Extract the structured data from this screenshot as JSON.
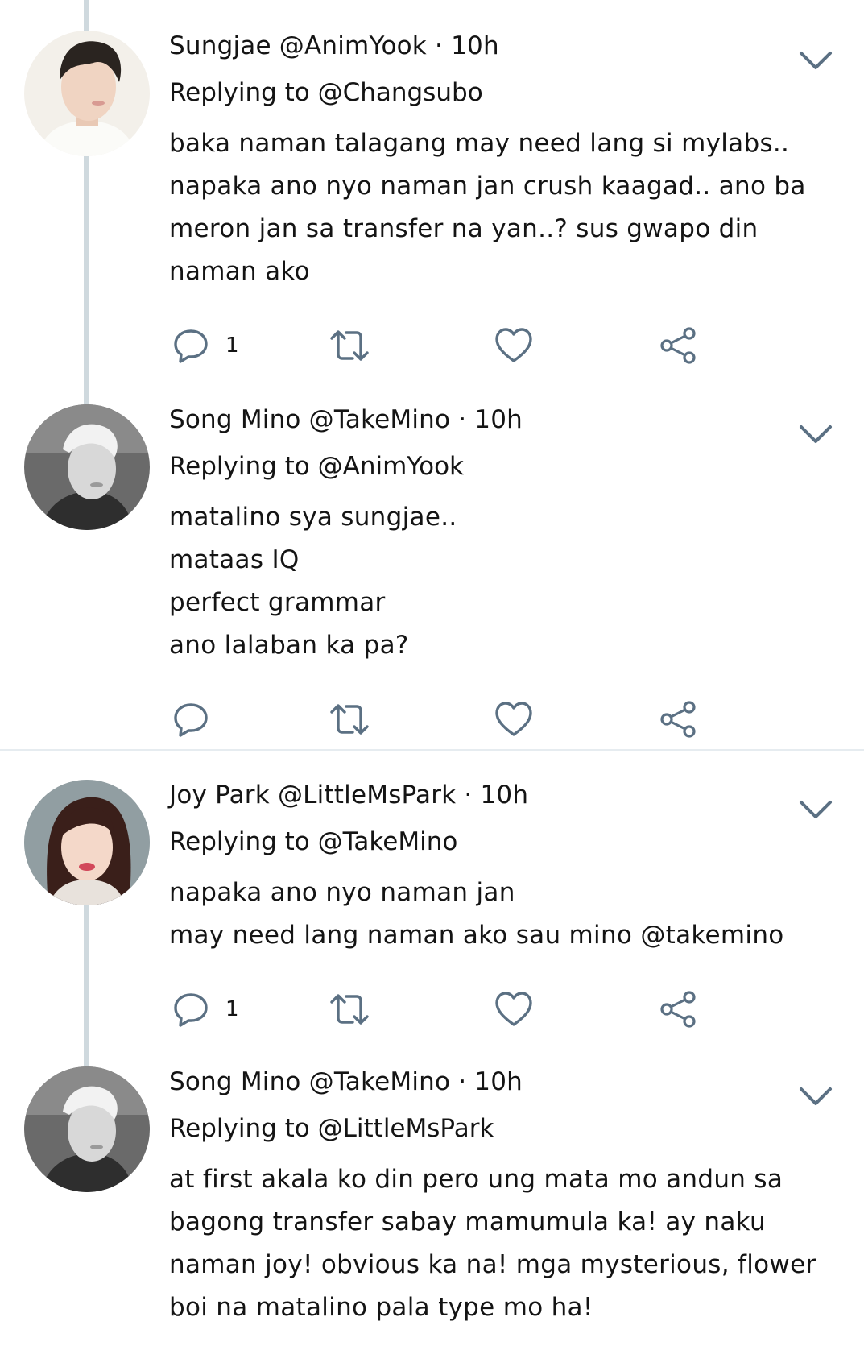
{
  "tweets": [
    {
      "name": "Sungjae",
      "handle": "@AnimYook",
      "time": "10h",
      "meta": "Sungjae @AnimYook · 10h",
      "replying_to": "Replying to @Changsubo",
      "lines": [
        "baka naman talagang may need lang si mylabs..",
        "napaka ano nyo naman jan crush kaagad.. ano ba",
        "meron jan sa transfer na yan..? sus gwapo din",
        "naman ako"
      ],
      "reply_count": "1"
    },
    {
      "name": "Song Mino",
      "handle": "@TakeMino",
      "time": "10h",
      "meta": "Song Mino @TakeMino · 10h",
      "replying_to": "Replying to @AnimYook",
      "lines": [
        "matalino sya sungjae..",
        "mataas IQ",
        "perfect grammar",
        "ano lalaban ka pa?"
      ],
      "reply_count": ""
    },
    {
      "name": "Joy Park",
      "handle": "@LittleMsPark",
      "time": "10h",
      "meta": "Joy Park @LittleMsPark · 10h",
      "replying_to": "Replying to @TakeMino",
      "lines": [
        "napaka ano nyo naman jan",
        "may need lang naman ako sau mino @takemino"
      ],
      "reply_count": "1"
    },
    {
      "name": "Song Mino",
      "handle": "@TakeMino",
      "time": "10h",
      "meta": "Song Mino @TakeMino · 10h",
      "replying_to": "Replying to @LittleMsPark",
      "lines": [
        "at first akala ko din pero ung mata mo andun sa",
        "bagong transfer sabay mamumula ka! ay naku",
        "naman joy! obvious ka na! mga mysterious, flower",
        "boi na matalino pala type mo ha!"
      ],
      "reply_count": ""
    }
  ],
  "icons": {
    "reply": "reply-icon",
    "retweet": "retweet-icon",
    "like": "heart-icon",
    "share": "share-icon",
    "more": "chevron-down-icon"
  },
  "colors": {
    "icon": "#5b7083",
    "thread_line": "#cfd9de",
    "divider": "#e6ecf0",
    "text": "#141414"
  }
}
